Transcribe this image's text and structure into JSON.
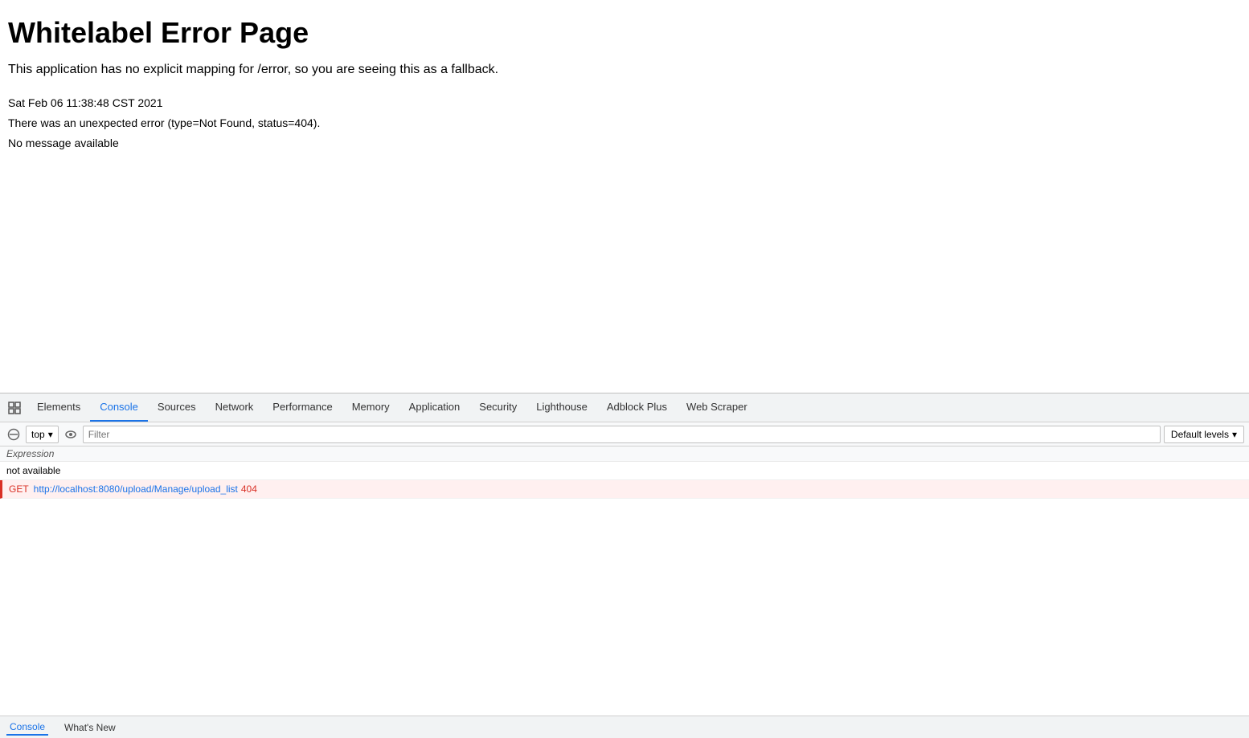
{
  "page": {
    "title": "Whitelabel Error Page",
    "subtitle": "This application has no explicit mapping for /error, so you are seeing this as a fallback.",
    "timestamp": "Sat Feb 06 11:38:48 CST 2021",
    "error_type": "There was an unexpected error (type=Not Found, status=404).",
    "error_message": "No message available"
  },
  "devtools": {
    "tabs": [
      {
        "id": "elements",
        "label": "Elements",
        "active": false
      },
      {
        "id": "console",
        "label": "Console",
        "active": true
      },
      {
        "id": "sources",
        "label": "Sources",
        "active": false
      },
      {
        "id": "network",
        "label": "Network",
        "active": false
      },
      {
        "id": "performance",
        "label": "Performance",
        "active": false
      },
      {
        "id": "memory",
        "label": "Memory",
        "active": false
      },
      {
        "id": "application",
        "label": "Application",
        "active": false
      },
      {
        "id": "security",
        "label": "Security",
        "active": false
      },
      {
        "id": "lighthouse",
        "label": "Lighthouse",
        "active": false
      },
      {
        "id": "adblock",
        "label": "Adblock Plus",
        "active": false
      },
      {
        "id": "webscraper",
        "label": "Web Scraper",
        "active": false
      }
    ],
    "console": {
      "context": "top",
      "filter_placeholder": "Filter",
      "levels_label": "Default levels",
      "expression_label": "Expression",
      "logs": [
        {
          "type": "expression",
          "text": "not available"
        },
        {
          "type": "error",
          "prefix": "GET",
          "url": "http://localhost:8080/upload/Manage/upload_list",
          "status": "404"
        }
      ]
    },
    "statusbar": [
      {
        "id": "console-status",
        "label": "Console",
        "active": true
      },
      {
        "id": "whatsnew-status",
        "label": "What's New",
        "active": false
      }
    ]
  },
  "icons": {
    "inspect": "⬚",
    "no_entry": "🚫",
    "eye": "👁",
    "chevron_down": "▾"
  }
}
